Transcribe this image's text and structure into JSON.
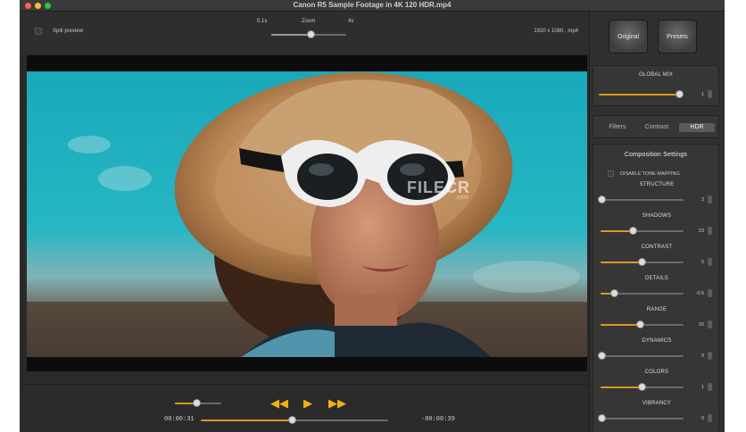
{
  "window": {
    "title": "Canon R5 Sample Footage in 4K 120 HDR.mp4"
  },
  "toolbar": {
    "split_preview_label": "Split preview",
    "zoom_label": "Zoom",
    "zoom_min_label": "0.1x",
    "zoom_max_label": "4x",
    "zoom_level": 0.53,
    "resolution_info": "1920 x 1080 , mp4"
  },
  "video": {
    "watermark": "FILECR",
    "watermark_sub": ".com"
  },
  "transport": {
    "volume_level": 0.48,
    "rewind_icon": "rewind-icon",
    "play_icon": "play-icon",
    "forward_icon": "fast-forward-icon",
    "elapsed": "00:00:31",
    "remaining": "-00:00:39",
    "progress": 0.49
  },
  "panel": {
    "original_label": "Original",
    "presets_label": "Presets",
    "global_mix": {
      "label": "GLOBAL MIX",
      "value": "1",
      "level": 0.98
    },
    "tabs": [
      {
        "label": "Filters",
        "active": false
      },
      {
        "label": "Contrast",
        "active": false
      },
      {
        "label": "HDR",
        "active": true
      }
    ],
    "composition": {
      "title": "Composition Settings",
      "disable_tone_mapping_label": "DISABLE TONE MAPPING",
      "sliders": [
        {
          "label": "STRUCTURE",
          "value": "2",
          "level": 0.02
        },
        {
          "label": "SHADOWS",
          "value": "23",
          "level": 0.4
        },
        {
          "label": "CONTRAST",
          "value": "5",
          "level": 0.5
        },
        {
          "label": "DETAILS",
          "value": "-0.5",
          "level": 0.17
        },
        {
          "label": "RANGE",
          "value": "15",
          "level": 0.48
        },
        {
          "label": "DYNAMICS",
          "value": "0",
          "level": 0.02
        },
        {
          "label": "COLORS",
          "value": "1",
          "level": 0.5
        },
        {
          "label": "VIBRANCY",
          "value": "0",
          "level": 0.02
        }
      ]
    }
  },
  "colors": {
    "accent": "#f2b20c",
    "slider_fill": "#d99a1e"
  }
}
